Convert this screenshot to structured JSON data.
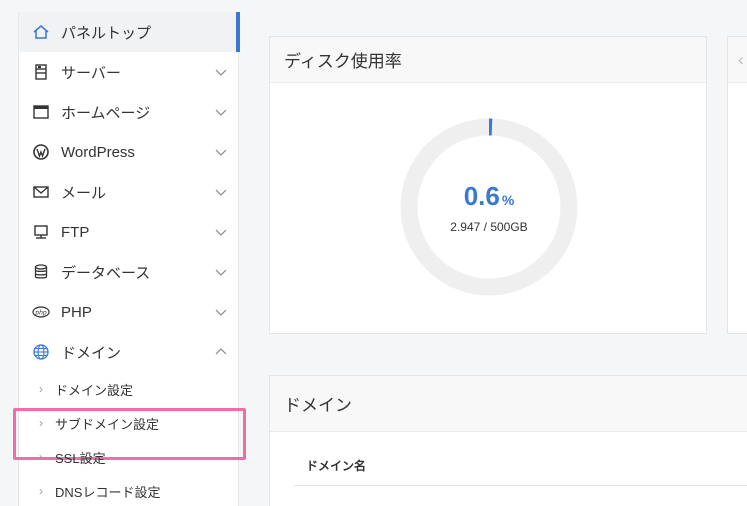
{
  "sidebar": {
    "items": [
      {
        "label": "パネルトップ",
        "icon": "home-icon"
      },
      {
        "label": "サーバー",
        "icon": "server-icon"
      },
      {
        "label": "ホームページ",
        "icon": "window-icon"
      },
      {
        "label": "WordPress",
        "icon": "wordpress-icon"
      },
      {
        "label": "メール",
        "icon": "mail-icon"
      },
      {
        "label": "FTP",
        "icon": "ftp-icon"
      },
      {
        "label": "データベース",
        "icon": "database-icon"
      },
      {
        "label": "PHP",
        "icon": "php-icon"
      },
      {
        "label": "ドメイン",
        "icon": "globe-icon"
      }
    ],
    "domain_sub_items": [
      {
        "label": "ドメイン設定"
      },
      {
        "label": "サブドメイン設定"
      },
      {
        "label": "SSL設定"
      },
      {
        "label": "DNSレコード設定"
      }
    ]
  },
  "disk_card": {
    "title": "ディスク使用率",
    "percent": "0.6",
    "percent_unit": "%",
    "usage": "2.947 / 500GB",
    "usage_fraction": 0.006
  },
  "domain_card": {
    "title": "ドメイン",
    "column_header": "ドメイン名"
  },
  "colors": {
    "accent": "#3a78d6",
    "highlight": "#f06ea8"
  }
}
